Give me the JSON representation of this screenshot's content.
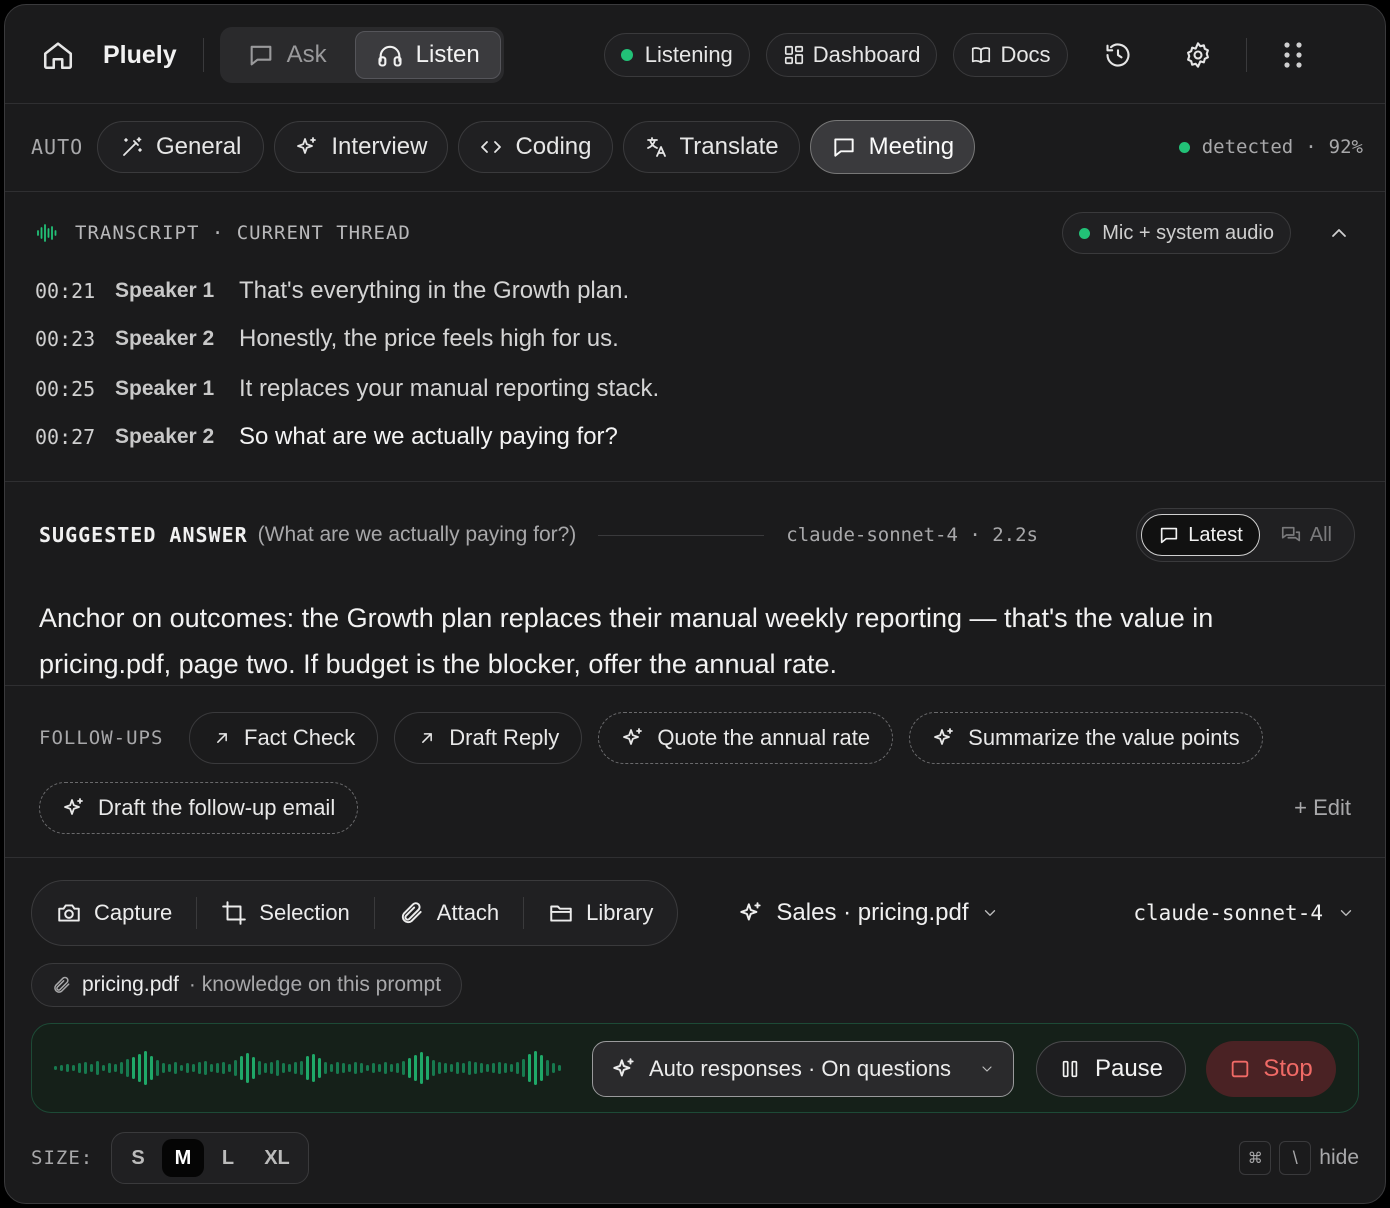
{
  "app": {
    "name": "Pluely"
  },
  "modes": {
    "ask": "Ask",
    "listen": "Listen"
  },
  "header": {
    "status": "Listening",
    "dashboard": "Dashboard",
    "docs": "Docs"
  },
  "contexts": {
    "auto": "AUTO",
    "items": [
      "General",
      "Interview",
      "Coding",
      "Translate",
      "Meeting"
    ],
    "active": "Meeting",
    "detected_label": "detected",
    "separator": "·",
    "confidence": "92%"
  },
  "transcript": {
    "title": "TRANSCRIPT · CURRENT THREAD",
    "source": "Mic + system audio",
    "lines": [
      {
        "time": "00:21",
        "speaker": "Speaker 1",
        "text": "That's everything in the Growth plan."
      },
      {
        "time": "00:23",
        "speaker": "Speaker 2",
        "text": "Honestly, the price feels high for us."
      },
      {
        "time": "00:25",
        "speaker": "Speaker 1",
        "text": "It replaces your manual reporting stack."
      },
      {
        "time": "00:27",
        "speaker": "Speaker 2",
        "text": "So what are we actually paying for?"
      }
    ]
  },
  "answer": {
    "title": "SUGGESTED ANSWER",
    "question": "(What are we actually paying for?)",
    "meta": "claude-sonnet-4 · 2.2s",
    "latest": "Latest",
    "all": "All",
    "line1": "Anchor on outcomes: the Growth plan replaces their manual weekly reporting — that's the value in",
    "line2": "pricing.pdf, page two. If budget is the blocker, offer the annual rate."
  },
  "followups": {
    "label": "FOLLOW-UPS",
    "actions": [
      "Fact Check",
      "Draft Reply"
    ],
    "suggestions": [
      "Quote the annual rate",
      "Summarize the value points",
      "Draft the follow-up email"
    ],
    "edit": "+ Edit"
  },
  "toolbar": {
    "capture": "Capture",
    "selection": "Selection",
    "attach": "Attach",
    "library": "Library",
    "knowledge": "Sales · pricing.pdf",
    "model": "claude-sonnet-4"
  },
  "attachment": {
    "name": "pricing.pdf",
    "note": "· knowledge on this prompt"
  },
  "controls": {
    "auto": "Auto responses · On questions",
    "pause": "Pause",
    "stop": "Stop"
  },
  "waveform": [
    2,
    3,
    4,
    3,
    5,
    6,
    4,
    7,
    3,
    5,
    4,
    6,
    9,
    11,
    14,
    17,
    12,
    8,
    5,
    4,
    6,
    3,
    5,
    4,
    6,
    7,
    4,
    5,
    6,
    4,
    8,
    12,
    15,
    11,
    7,
    5,
    6,
    8,
    5,
    4,
    6,
    7,
    12,
    14,
    10,
    6,
    4,
    6,
    5,
    4,
    6,
    5,
    3,
    5,
    4,
    6,
    4,
    5,
    7,
    10,
    13,
    16,
    12,
    8,
    6,
    5,
    4,
    6,
    5,
    7,
    6,
    5,
    4,
    5,
    6,
    5,
    4,
    6,
    9,
    14,
    17,
    13,
    8,
    5,
    3
  ],
  "footer": {
    "size_label": "SIZE:",
    "sizes": [
      "S",
      "M",
      "L",
      "XL"
    ],
    "active_size": "M",
    "key1": "⌘",
    "key2": "\\",
    "hide": "hide"
  },
  "colors": {
    "accent": "#22c177",
    "stop": "#f06a66",
    "bg": "#1b1b1c"
  }
}
